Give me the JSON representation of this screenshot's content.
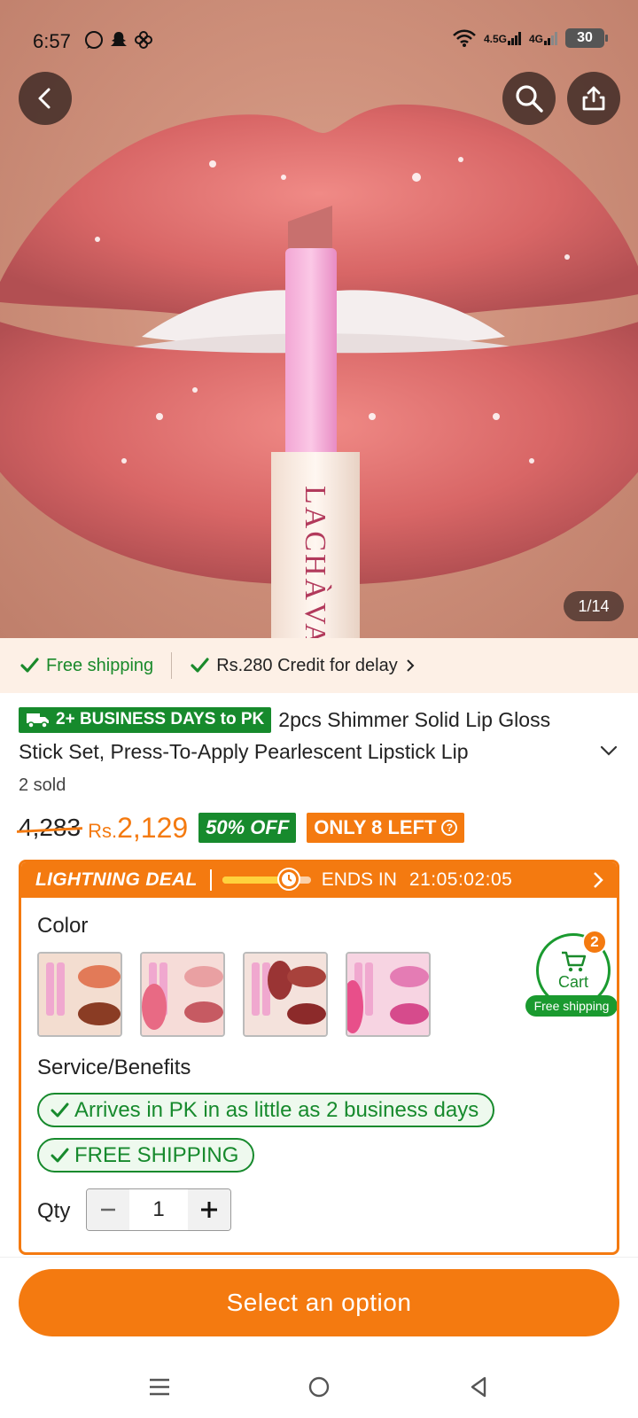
{
  "status": {
    "time": "6:57",
    "network1": "4.5G",
    "network2": "4G",
    "battery": "30"
  },
  "hero": {
    "counter": "1/14",
    "product_brand_on_image": "LACHÀVA"
  },
  "shipping_strip": {
    "free_shipping": "Free shipping",
    "credit": "Rs.280 Credit for delay"
  },
  "product": {
    "delivery_badge": "2+ BUSINESS DAYS to PK",
    "title_line1": "2pcs Shimmer Solid Lip Gloss",
    "title_line2": "Stick Set, Press-To-Apply Pearlescent Lipstick Lip",
    "sold": "2 sold",
    "price_old": "4,283",
    "currency": "Rs.",
    "price_current": "2,129",
    "discount": "50% OFF",
    "stock": "ONLY 8 LEFT"
  },
  "deal": {
    "label": "LIGHTNING DEAL",
    "ends_in_label": "ENDS IN",
    "timer": "21:05:02:05",
    "progress_fraction": 0.75
  },
  "options": {
    "color_label": "Color",
    "swatch_count": 4,
    "service_label": "Service/Benefits",
    "benefit_1": "Arrives in PK in as little as 2 business days",
    "benefit_2": "FREE SHIPPING",
    "qty_label": "Qty",
    "qty_value": "1"
  },
  "cart": {
    "label": "Cart",
    "count": "2",
    "free_shipping": "Free shipping"
  },
  "cta": {
    "label": "Select an option"
  },
  "colors": {
    "accent_orange": "#f47a10",
    "green": "#178a2d",
    "strip_bg": "#fdf0e6"
  }
}
